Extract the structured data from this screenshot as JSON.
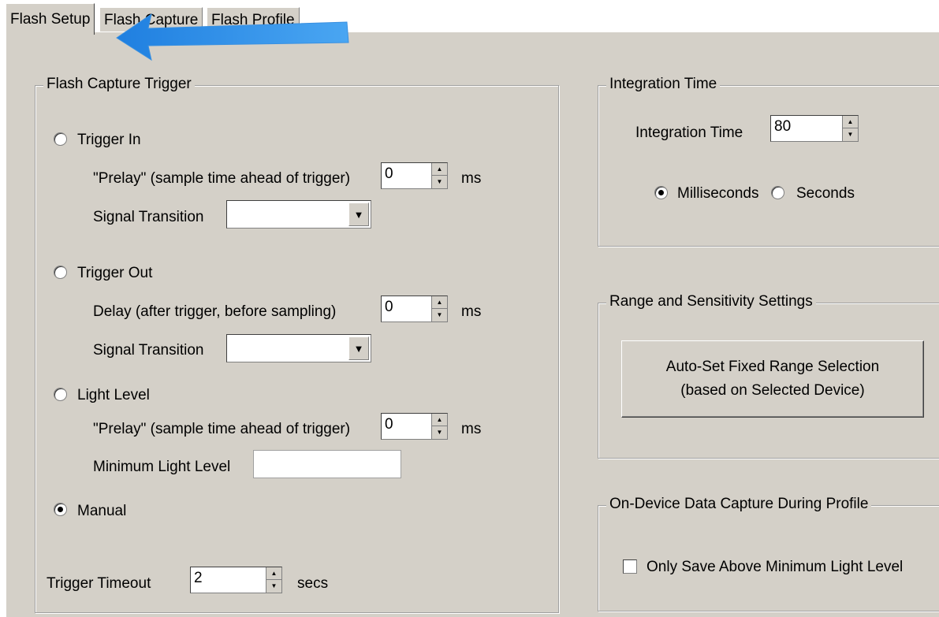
{
  "tabs": [
    "Flash Setup",
    "Flash Capture",
    "Flash Profile"
  ],
  "active_tab": "Flash Setup",
  "trigger_group": {
    "title": "Flash Capture Trigger",
    "trigger_in": {
      "label": "Trigger In",
      "checked": false,
      "prelay_label": "\"Prelay\" (sample time ahead of trigger)",
      "prelay_value": "0",
      "prelay_unit": "ms",
      "signal_label": "Signal Transition",
      "signal_value": ""
    },
    "trigger_out": {
      "label": "Trigger Out",
      "checked": false,
      "delay_label": "Delay (after trigger, before sampling)",
      "delay_value": "0",
      "delay_unit": "ms",
      "signal_label": "Signal Transition",
      "signal_value": ""
    },
    "light_level": {
      "label": "Light Level",
      "checked": false,
      "prelay_label": "\"Prelay\" (sample time ahead of trigger)",
      "prelay_value": "0",
      "prelay_unit": "ms",
      "min_label": "Minimum Light Level",
      "min_value": ""
    },
    "manual": {
      "label": "Manual",
      "checked": true
    },
    "timeout": {
      "label": "Trigger Timeout",
      "value": "2",
      "unit": "secs"
    }
  },
  "integration_group": {
    "title": "Integration Time",
    "label": "Integration Time",
    "value": "80",
    "milliseconds_label": "Milliseconds",
    "milliseconds_checked": true,
    "seconds_label": "Seconds",
    "seconds_checked": false
  },
  "range_group": {
    "title": "Range and Sensitivity Settings",
    "button_line1": "Auto-Set Fixed Range Selection",
    "button_line2": "(based on Selected Device)"
  },
  "capture_group": {
    "title": "On-Device Data Capture During Profile",
    "checkbox_label": "Only Save Above Minimum Light Level",
    "checkbox_checked": false
  },
  "icons": {
    "spin_up": "spin-up-icon",
    "spin_down": "spin-down-icon",
    "dropdown": "dropdown-arrow-icon",
    "annotation": "arrow-annotation-icon"
  },
  "colors": {
    "panel_bg": "#d4d0c8",
    "annotation_arrow": "#2f8fe8"
  }
}
